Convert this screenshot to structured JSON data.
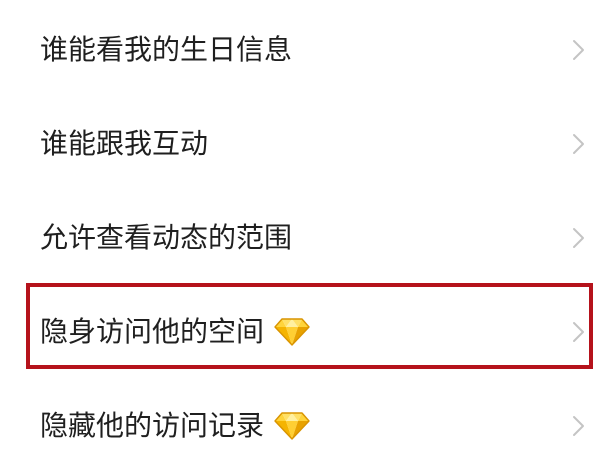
{
  "settings": {
    "items": [
      {
        "label": "谁能看我的生日信息",
        "premium": false,
        "highlighted": false
      },
      {
        "label": "谁能跟我互动",
        "premium": false,
        "highlighted": false
      },
      {
        "label": "允许查看动态的范围",
        "premium": false,
        "highlighted": false
      },
      {
        "label": "隐身访问他的空间",
        "premium": true,
        "highlighted": true
      },
      {
        "label": "隐藏他的访问记录",
        "premium": true,
        "highlighted": false
      }
    ]
  },
  "icons": {
    "row_arrow": "chevron-right-icon",
    "premium_badge": "diamond-icon"
  },
  "colors": {
    "background": "#ffffff",
    "text": "#1f1f1f",
    "chevron": "#c4c4c4",
    "highlight": "#b5121b",
    "diamond": "#f7b500"
  }
}
